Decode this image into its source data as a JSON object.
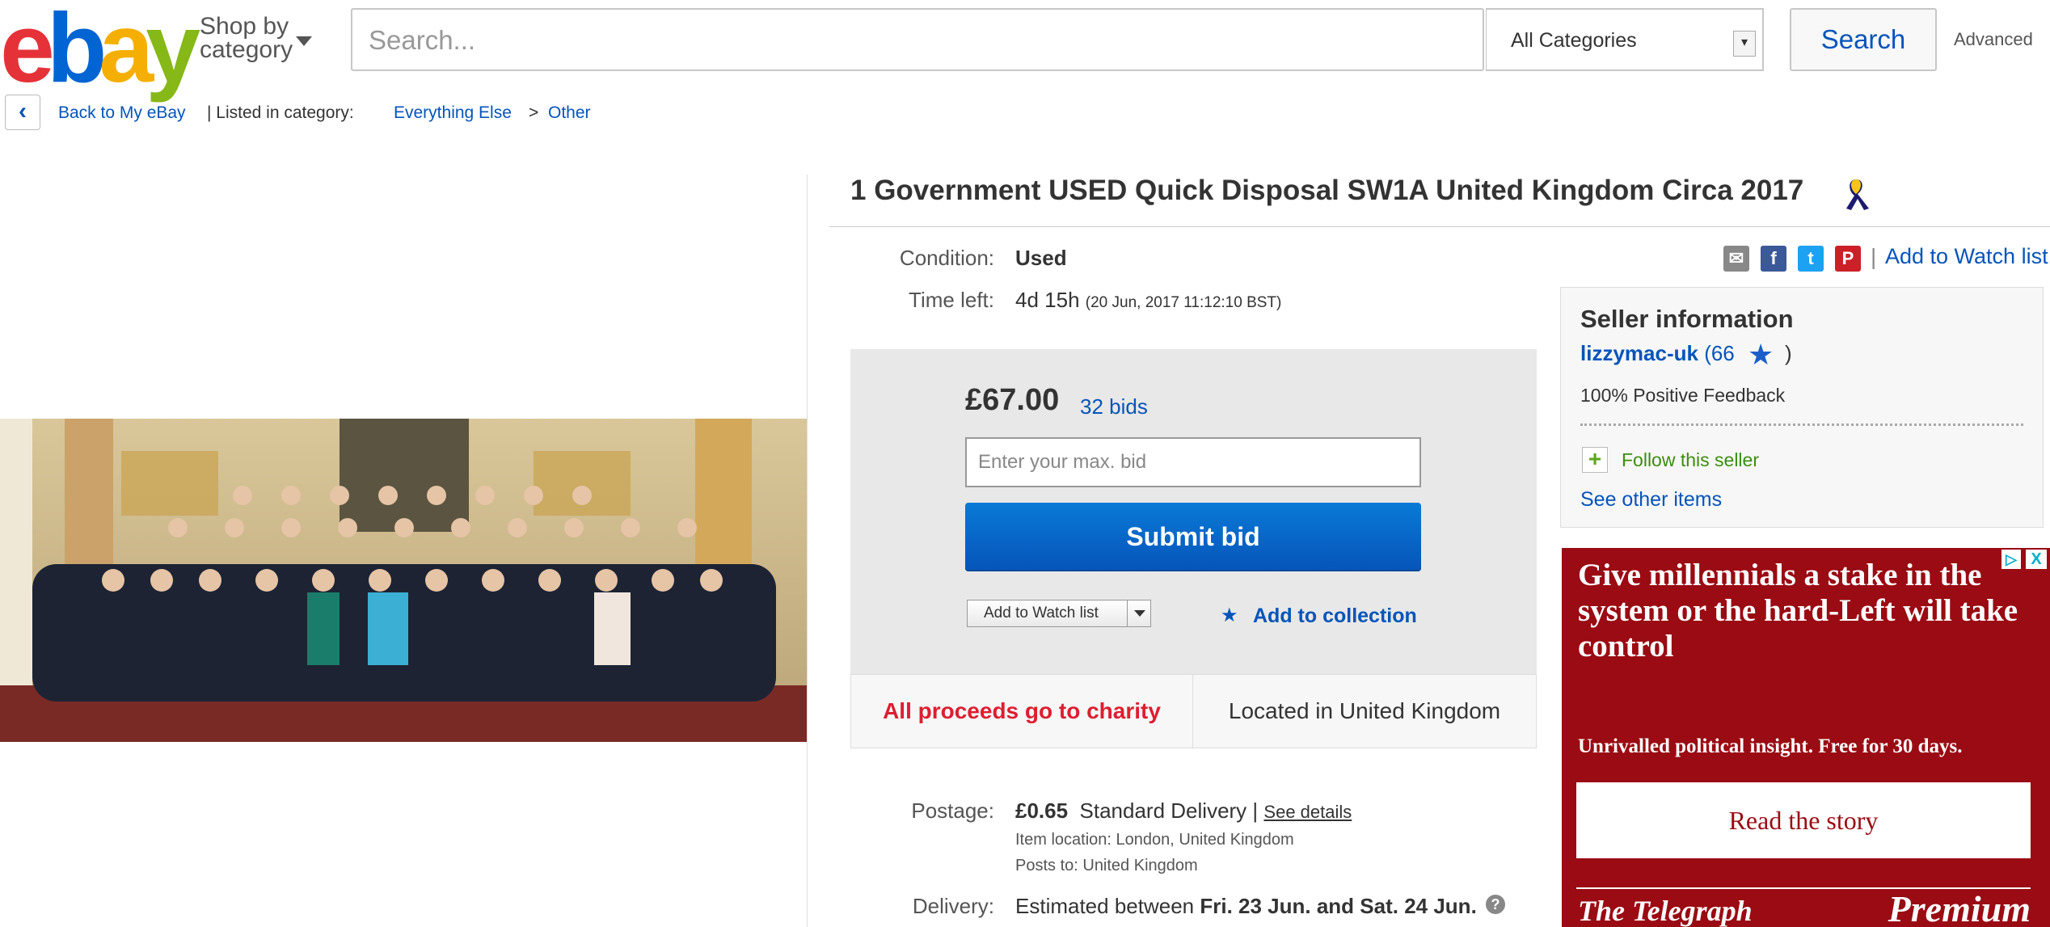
{
  "header": {
    "logo": [
      "e",
      "b",
      "a",
      "y"
    ],
    "shop_by_line1": "Shop by",
    "shop_by_line2": "category",
    "search_placeholder": "Search...",
    "category": "All Categories",
    "search_button": "Search",
    "advanced": "Advanced"
  },
  "breadcrumb": {
    "back": "Back to My eBay",
    "listed_in": "|  Listed in category:",
    "cat1": "Everything Else",
    "sep": ">",
    "cat2": "Other"
  },
  "item": {
    "title": "1 Government USED Quick Disposal SW1A United Kingdom Circa 2017",
    "condition_label": "Condition:",
    "condition": "Used",
    "time_label": "Time left:",
    "time_left": "4d 15h",
    "time_end": "(20 Jun, 2017   11:12:10 BST)"
  },
  "share": {
    "mail": "✉",
    "facebook": "f",
    "twitter": "t",
    "pinterest": "P",
    "sep": "|",
    "watch": "Add to Watch list"
  },
  "bid": {
    "price": "£67.00",
    "bids": "32 bids",
    "placeholder": "Enter your max. bid",
    "submit": "Submit bid",
    "watch": "Add to Watch list",
    "collection": "Add to collection",
    "charity": "All proceeds go to charity",
    "located": "Located in United Kingdom"
  },
  "postage": {
    "label": "Postage:",
    "price": "£0.65",
    "method": "Standard Delivery |",
    "details": "See details",
    "item_location": "Item location:  London, United Kingdom",
    "posts_to": "Posts to:  United Kingdom",
    "delivery_label": "Delivery:",
    "delivery_prefix": "Estimated between ",
    "delivery_dates": "Fri. 23 Jun. and Sat. 24 Jun.",
    "help": "?"
  },
  "seller": {
    "heading": "Seller information",
    "name": "lizzymac-uk",
    "score": "(66",
    "close": ")",
    "feedback": "100% Positive Feedback",
    "follow": "Follow this seller",
    "other_items": "See other items"
  },
  "ad": {
    "headline": "Give millennials a stake in the system or the hard-Left will take control",
    "sub": "Unrivalled political insight. Free for 30 days.",
    "button": "Read the story",
    "brand": "The Telegraph",
    "premium": "Premium",
    "choices": "▷",
    "close": "X"
  },
  "colors": {
    "ebay_blue": "#0654ba",
    "charity_red": "#dd1e31",
    "ad_red": "#9a0b13"
  }
}
